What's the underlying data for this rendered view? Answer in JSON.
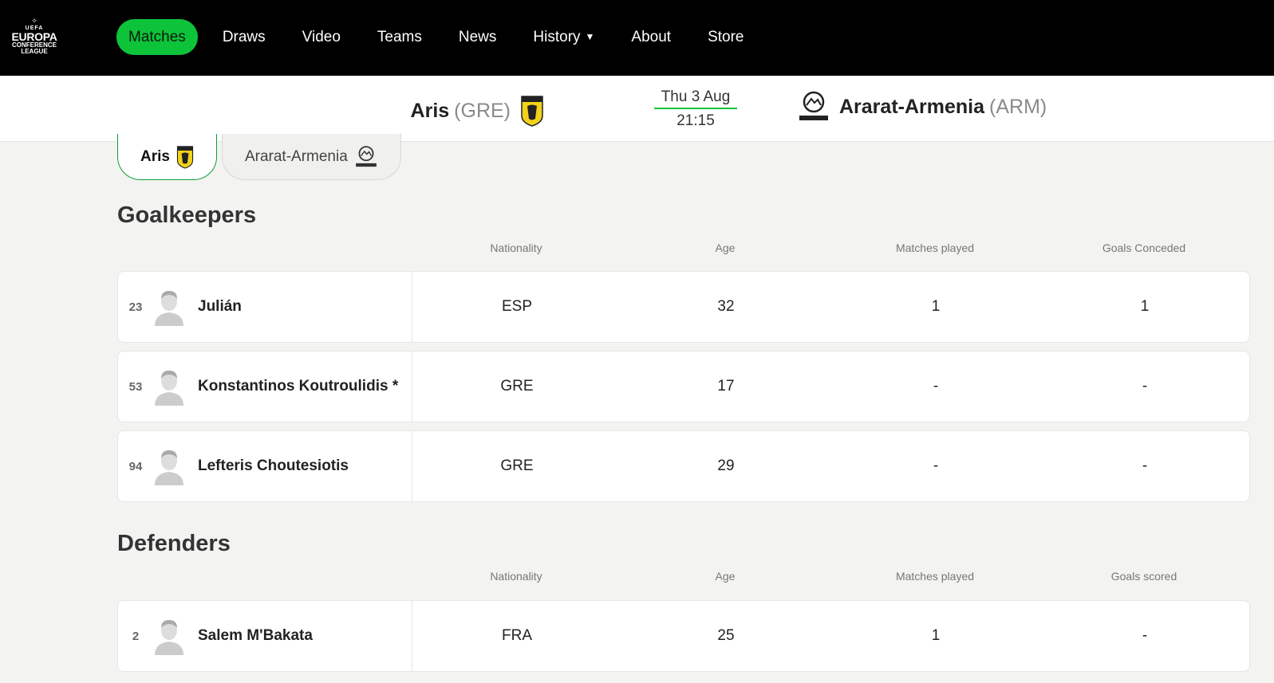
{
  "nav": {
    "logo": {
      "uefa": "UEFA",
      "line1": "EUROPA",
      "line2": "CONFERENCE",
      "line3": "LEAGUE"
    },
    "items": [
      {
        "label": "Matches",
        "active": true
      },
      {
        "label": "Draws"
      },
      {
        "label": "Video"
      },
      {
        "label": "Teams"
      },
      {
        "label": "News"
      },
      {
        "label": "History",
        "caret": true
      },
      {
        "label": "About"
      },
      {
        "label": "Store"
      }
    ]
  },
  "match": {
    "home": {
      "name": "Aris",
      "code": "(GRE)",
      "crest_color": "#f2d21b"
    },
    "away": {
      "name": "Ararat-Armenia",
      "code": "(ARM)"
    },
    "date": "Thu 3 Aug",
    "time": "21:15"
  },
  "team_tabs": [
    {
      "label": "Aris",
      "active": true
    },
    {
      "label": "Ararat-Armenia",
      "active": false
    }
  ],
  "goalkeepers": {
    "title": "Goalkeepers",
    "headers": [
      "Nationality",
      "Age",
      "Matches played",
      "Goals Conceded"
    ],
    "rows": [
      {
        "num": "23",
        "name": "Julián",
        "nat": "ESP",
        "age": "32",
        "mp": "1",
        "stat": "1"
      },
      {
        "num": "53",
        "name": "Konstantinos Koutroulidis *",
        "nat": "GRE",
        "age": "17",
        "mp": "-",
        "stat": "-"
      },
      {
        "num": "94",
        "name": "Lefteris Choutesiotis",
        "nat": "GRE",
        "age": "29",
        "mp": "-",
        "stat": "-"
      }
    ]
  },
  "defenders": {
    "title": "Defenders",
    "headers": [
      "Nationality",
      "Age",
      "Matches played",
      "Goals scored"
    ],
    "rows": [
      {
        "num": "2",
        "name": "Salem M'Bakata",
        "nat": "FRA",
        "age": "25",
        "mp": "1",
        "stat": "-"
      }
    ]
  },
  "colors": {
    "accent": "#0dc33a",
    "nav_bg": "#000000"
  }
}
